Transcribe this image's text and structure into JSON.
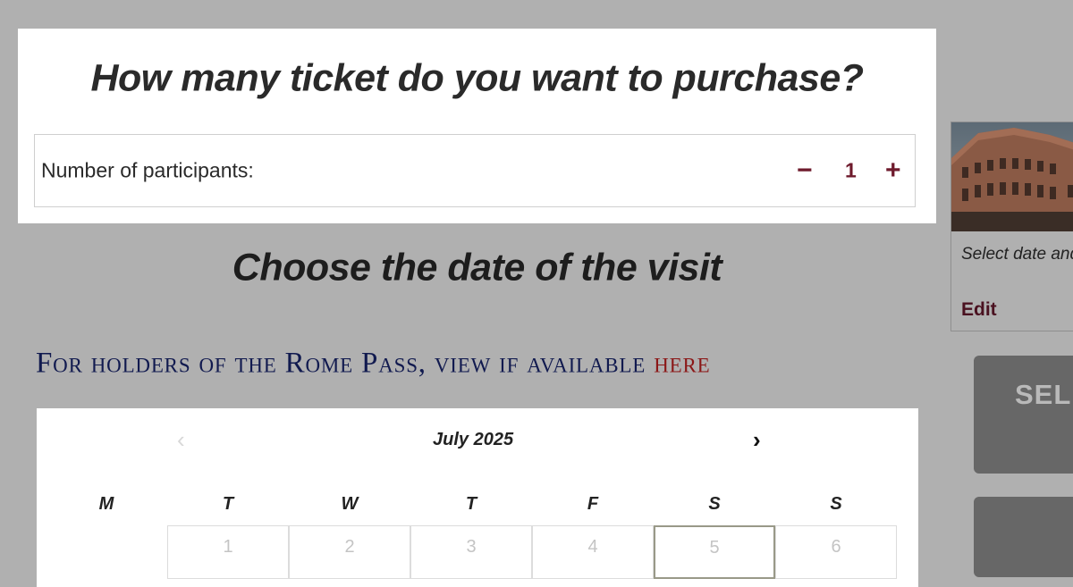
{
  "tickets": {
    "title": "How many ticket do you want to purchase?",
    "participants_label": "Number of participants:",
    "minus": "−",
    "quantity": "1",
    "plus": "+"
  },
  "date": {
    "title": "Choose the date of the visit",
    "rome_pass_text": "For holders of the Rome Pass, view if available ",
    "rome_pass_link": "here"
  },
  "calendar": {
    "prev": "‹",
    "month": "July 2025",
    "next": "›",
    "weekdays": [
      "M",
      "T",
      "W",
      "T",
      "F",
      "S",
      "S"
    ],
    "days": [
      "1",
      "2",
      "3",
      "4",
      "5",
      "6"
    ],
    "selected_day": "5"
  },
  "sidebar": {
    "summary_text": "Select date and",
    "edit_label": "Edit",
    "select_button_label": "SELE"
  },
  "colors": {
    "accent": "#6e1a2c",
    "overlay": "#b0b0b0",
    "rome_pass_text": "#111a4f",
    "rome_pass_link": "#8b1717"
  }
}
